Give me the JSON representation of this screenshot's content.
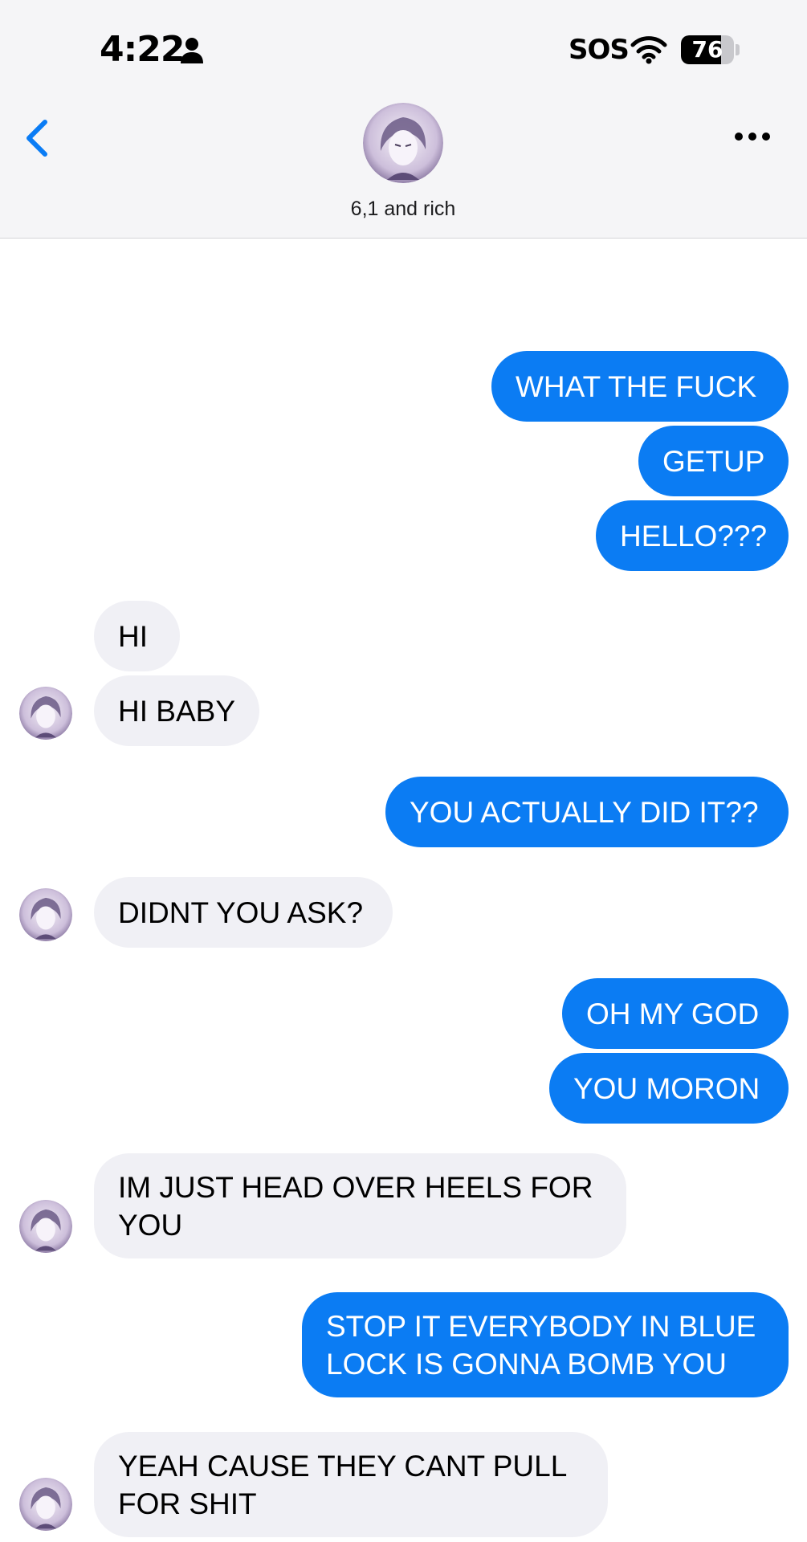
{
  "status_bar": {
    "time": "4:22",
    "carrier": "SOS",
    "battery_percent": "76",
    "battery_level": 0.76
  },
  "header": {
    "contact_name": "6,1 and rich",
    "icons": [
      "back-chevron-icon",
      "more-dots-icon",
      "person-icon",
      "wifi-icon"
    ]
  },
  "colors": {
    "outgoing_bubble": "#0b7cf3",
    "incoming_bubble": "#f0f0f5",
    "accent": "#0a7cf5"
  },
  "messages": [
    {
      "from": "me",
      "text": "WHAT THE FUCK"
    },
    {
      "from": "me",
      "text": "GETUP"
    },
    {
      "from": "me",
      "text": "HELLO???"
    },
    {
      "from": "them",
      "text": "HI"
    },
    {
      "from": "them",
      "text": "HI BABY"
    },
    {
      "from": "me",
      "text": "YOU ACTUALLY DID IT??"
    },
    {
      "from": "them",
      "text": "DIDNT YOU ASK?"
    },
    {
      "from": "me",
      "text": "OH MY GOD"
    },
    {
      "from": "me",
      "text": "YOU MORON"
    },
    {
      "from": "them",
      "lines": [
        "IM JUST HEAD OVER HEELS FOR",
        "YOU"
      ]
    },
    {
      "from": "me",
      "lines": [
        "STOP IT EVERYBODY IN BLUE",
        "LOCK IS GONNA BOMB YOU"
      ]
    },
    {
      "from": "them",
      "lines": [
        "YEAH CAUSE THEY CANT PULL",
        "FOR SHIT"
      ]
    }
  ]
}
